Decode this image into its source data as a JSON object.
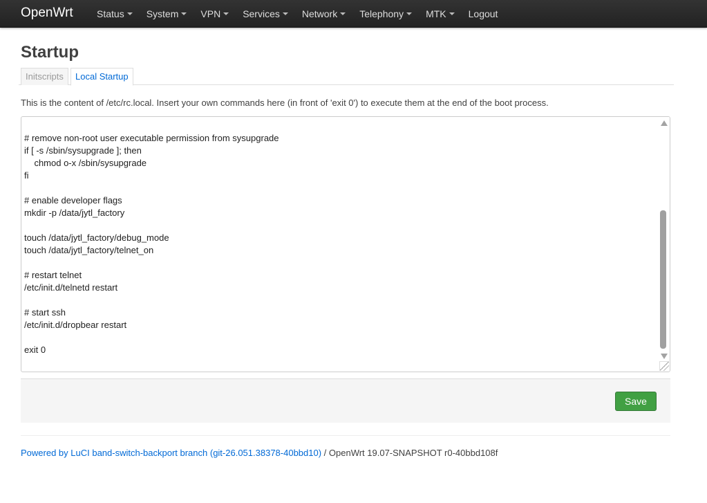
{
  "brand": "OpenWrt",
  "menu": [
    {
      "label": "Status",
      "dropdown": true
    },
    {
      "label": "System",
      "dropdown": true
    },
    {
      "label": "VPN",
      "dropdown": true
    },
    {
      "label": "Services",
      "dropdown": true
    },
    {
      "label": "Network",
      "dropdown": true
    },
    {
      "label": "Telephony",
      "dropdown": true
    },
    {
      "label": "MTK",
      "dropdown": true
    },
    {
      "label": "Logout",
      "dropdown": false
    }
  ],
  "page": {
    "title": "Startup",
    "tabs": [
      {
        "label": "Initscripts",
        "active": false
      },
      {
        "label": "Local Startup",
        "active": true
      }
    ],
    "description": "This is the content of /etc/rc.local. Insert your own commands here (in front of 'exit 0') to execute them at the end of the boot process."
  },
  "editor": {
    "content": "# remove non-root user executable permission from sysupgrade\nif [ -s /sbin/sysupgrade ]; then\n    chmod o-x /sbin/sysupgrade\nfi\n\n# enable developer flags\nmkdir -p /data/jytl_factory\n\ntouch /data/jytl_factory/debug_mode\ntouch /data/jytl_factory/telnet_on\n\n# restart telnet\n/etc/init.d/telnetd restart\n\n# start ssh\n/etc/init.d/dropbear restart\n\nexit 0"
  },
  "actions": {
    "save_label": "Save",
    "save_color": "#41a043"
  },
  "footer": {
    "link_text": "Powered by LuCI band-switch-backport branch (git-26.051.38378-40bbd10)",
    "separator": " / ",
    "version": "OpenWrt 19.07-SNAPSHOT r0-40bbd108f"
  },
  "colors": {
    "navbar": "#222222",
    "link": "#0069d6"
  }
}
